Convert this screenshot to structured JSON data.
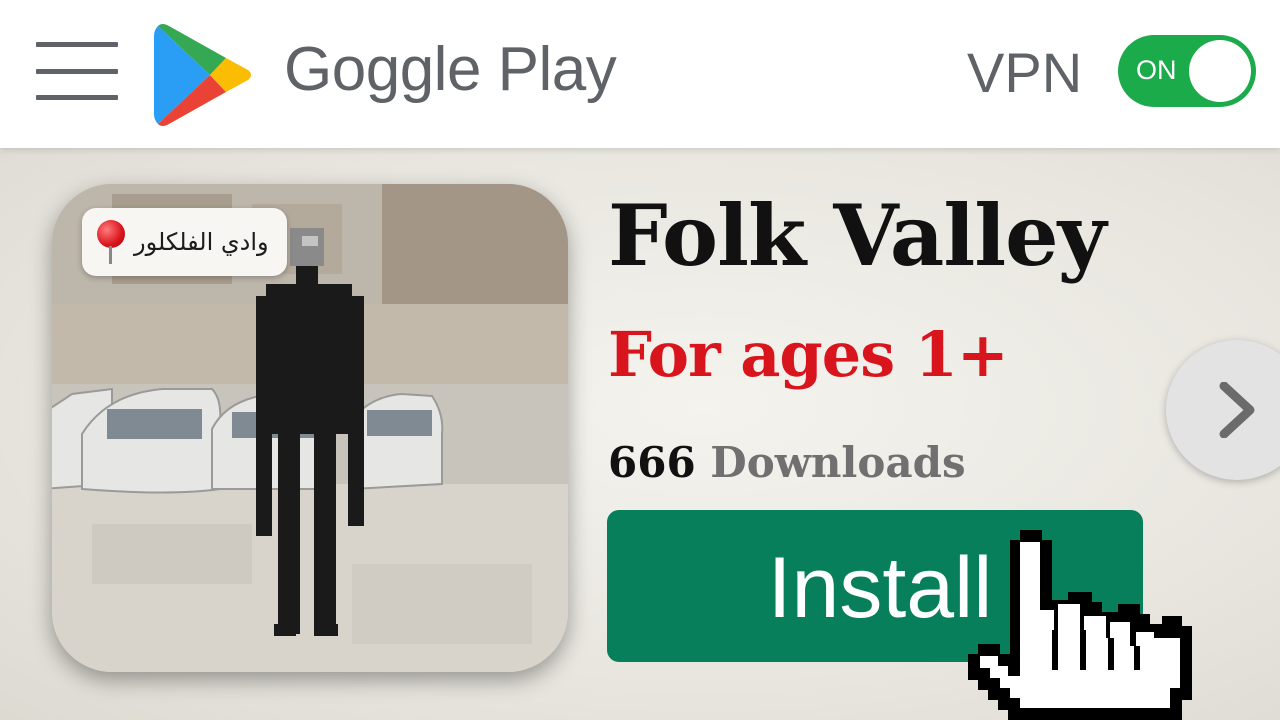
{
  "header": {
    "menu_icon": "hamburger-menu-icon",
    "logo_icon": "play-store-logo-icon",
    "brand": "Goggle Play",
    "vpn": {
      "label": "VPN",
      "toggle_text": "ON",
      "state": "on"
    }
  },
  "app": {
    "icon_overlay_text": "وادي الفلكلور",
    "pin_icon": "map-pin-icon",
    "title": "Folk Valley",
    "age_rating": "For ages 1+",
    "download_count": "666",
    "download_label": "Downloads",
    "install_label": "Install",
    "next_icon": "chevron-right-icon",
    "cursor_icon": "hand-pointer-cursor-icon"
  },
  "colors": {
    "toggle_on": "#1bab4b",
    "install_button": "#087f5b",
    "age_rating": "#d8141d",
    "brand_text": "#5f6368"
  }
}
